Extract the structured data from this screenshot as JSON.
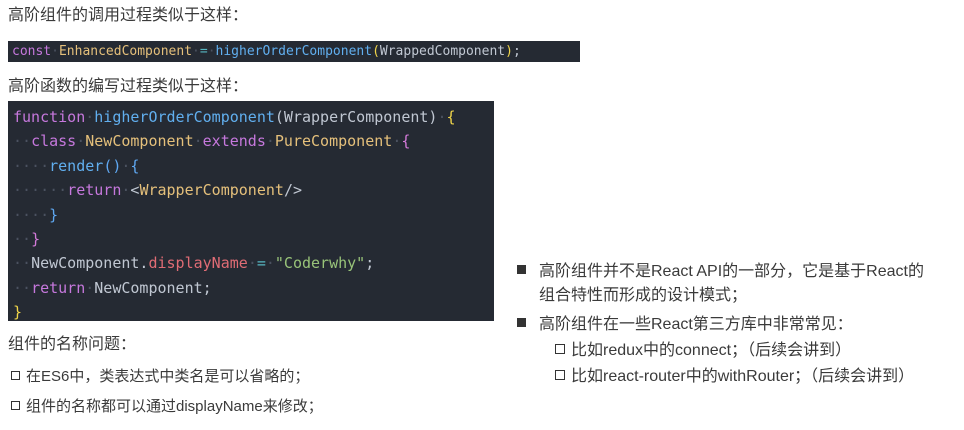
{
  "heading1": "高阶组件的调用过程类似于这样：",
  "inline_code": [
    {
      "t": "const",
      "c": "kw"
    },
    {
      "t": "·",
      "c": "dot"
    },
    {
      "t": "EnhancedComponent",
      "c": "class"
    },
    {
      "t": "·",
      "c": "dot"
    },
    {
      "t": "=",
      "c": "op"
    },
    {
      "t": "·",
      "c": "dot"
    },
    {
      "t": "higherOrderComponent",
      "c": "fn"
    },
    {
      "t": "(",
      "c": "br1"
    },
    {
      "t": "WrappedComponent",
      "c": "plain"
    },
    {
      "t": ")",
      "c": "br1"
    },
    {
      "t": ";",
      "c": "plain"
    }
  ],
  "heading2": "高阶函数的编写过程类似于这样：",
  "code_lines": [
    [
      {
        "t": "function",
        "c": "kw"
      },
      {
        "t": "·",
        "c": "dot"
      },
      {
        "t": "higherOrderComponent",
        "c": "fn"
      },
      {
        "t": "(WrapperComponent)",
        "c": "plain"
      },
      {
        "t": "·",
        "c": "dot"
      },
      {
        "t": "{",
        "c": "br1"
      }
    ],
    [
      {
        "t": "··",
        "c": "dot"
      },
      {
        "t": "class",
        "c": "kw"
      },
      {
        "t": "·",
        "c": "dot"
      },
      {
        "t": "NewComponent",
        "c": "class"
      },
      {
        "t": "·",
        "c": "dot"
      },
      {
        "t": "extends",
        "c": "kw"
      },
      {
        "t": "·",
        "c": "dot"
      },
      {
        "t": "PureComponent",
        "c": "class"
      },
      {
        "t": "·",
        "c": "dot"
      },
      {
        "t": "{",
        "c": "br2"
      }
    ],
    [
      {
        "t": "····",
        "c": "dot"
      },
      {
        "t": "render",
        "c": "fn"
      },
      {
        "t": "()",
        "c": "br3"
      },
      {
        "t": "·",
        "c": "dot"
      },
      {
        "t": "{",
        "c": "br3"
      }
    ],
    [
      {
        "t": "······",
        "c": "dot"
      },
      {
        "t": "return",
        "c": "kw"
      },
      {
        "t": "·",
        "c": "dot"
      },
      {
        "t": "<",
        "c": "plain"
      },
      {
        "t": "WrapperComponent",
        "c": "class"
      },
      {
        "t": "/>",
        "c": "plain"
      }
    ],
    [
      {
        "t": "····",
        "c": "dot"
      },
      {
        "t": "}",
        "c": "br3"
      }
    ],
    [
      {
        "t": "··",
        "c": "dot"
      },
      {
        "t": "}",
        "c": "br2"
      }
    ],
    [
      {
        "t": "··",
        "c": "dot"
      },
      {
        "t": "NewComponent.",
        "c": "plain"
      },
      {
        "t": "displayName",
        "c": "prop"
      },
      {
        "t": "·",
        "c": "dot"
      },
      {
        "t": "=",
        "c": "op"
      },
      {
        "t": "·",
        "c": "dot"
      },
      {
        "t": "\"Coderwhy\"",
        "c": "str"
      },
      {
        "t": ";",
        "c": "plain"
      }
    ],
    [
      {
        "t": "··",
        "c": "dot"
      },
      {
        "t": "return",
        "c": "kw"
      },
      {
        "t": "·",
        "c": "dot"
      },
      {
        "t": "NewComponent;",
        "c": "plain"
      }
    ],
    [
      {
        "t": "}",
        "c": "br1"
      }
    ]
  ],
  "heading3": "组件的名称问题：",
  "left_bullets": [
    "在ES6中，类表达式中类名是可以省略的；",
    "组件的名称都可以通过displayName来修改；"
  ],
  "right_bullets": [
    {
      "line1": "高阶组件并不是React API的一部分，它是基于React的",
      "line2": "组合特性而形成的设计模式；"
    },
    {
      "line1": "高阶组件在一些React第三方库中非常常见："
    }
  ],
  "right_sub_bullets": [
    "比如redux中的connect；（后续会讲到）",
    "比如react-router中的withRouter；（后续会讲到）"
  ]
}
